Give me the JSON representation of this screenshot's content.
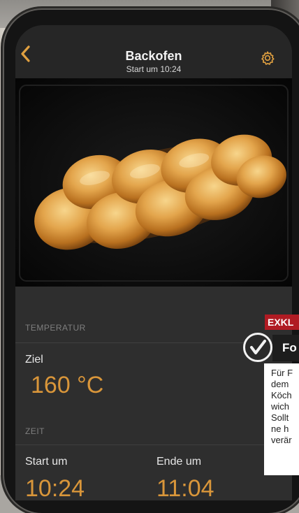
{
  "header": {
    "title": "Backofen",
    "subtitle": "Start um 10:24",
    "back_icon": "chevron-left-icon",
    "settings_icon": "gear-icon"
  },
  "photo": {
    "subject": "braided-bread-in-oven"
  },
  "temperature": {
    "section_label": "TEMPERATUR",
    "target_label": "Ziel",
    "target_value": "160 °C"
  },
  "time": {
    "section_label": "ZEIT",
    "start_label": "Start um",
    "start_value": "10:24",
    "end_label": "Ende um",
    "end_value": "11:04"
  },
  "magazine": {
    "badge": "EXKL",
    "tag": "Fo",
    "text_lines": [
      "Für F",
      "dem",
      "Köch",
      "wich",
      "Sollt",
      "ne h",
      "verär"
    ]
  },
  "colors": {
    "accent": "#d9963a",
    "background": "#2e2e2e",
    "magazine_red": "#b01b23"
  }
}
